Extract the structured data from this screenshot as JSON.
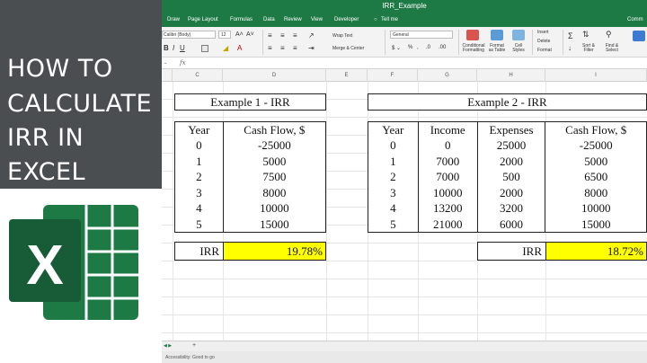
{
  "banner": {
    "lines": [
      "HOW TO",
      "CALCULATE",
      "IRR IN",
      "EXCEL"
    ],
    "bg_color": "#4b4e51",
    "logo_icon": "excel-logo-icon",
    "logo_color": "#1e7a45"
  },
  "window": {
    "title": "IRR_Example",
    "menu": [
      "Draw",
      "Page Layout",
      "Formulas",
      "Data",
      "Review",
      "View",
      "Developer",
      "Tell me",
      "Comm"
    ],
    "accent": "#1e7a45"
  },
  "ribbon": {
    "font_name": "Calibri (Body)",
    "font_size": "12",
    "wrap_text": "Wrap Text",
    "merge_center": "Merge & Center",
    "number_format": "General",
    "conditional_formatting": "Conditional Formatting",
    "format_as_table": "Format as Table",
    "cell_styles": "Cell Styles",
    "insert": "Insert",
    "delete": "Delete",
    "format": "Format",
    "sort_filter": "Sort & Filter",
    "find_select": "Find & Select"
  },
  "formula_bar": {
    "fx": "fx"
  },
  "columns": [
    "C",
    "D",
    "E",
    "F",
    "G",
    "H",
    "I"
  ],
  "example1": {
    "title": "Example 1 - IRR",
    "headers": [
      "Year",
      "Cash Flow, $"
    ],
    "rows": [
      [
        "0",
        "-25000"
      ],
      [
        "1",
        "5000"
      ],
      [
        "2",
        "7500"
      ],
      [
        "3",
        "8000"
      ],
      [
        "4",
        "10000"
      ],
      [
        "5",
        "15000"
      ]
    ],
    "irr_label": "IRR",
    "irr_value": "19.78%"
  },
  "example2": {
    "title": "Example 2 - IRR",
    "headers": [
      "Year",
      "Income",
      "Expenses",
      "Cash Flow, $"
    ],
    "rows": [
      [
        "0",
        "0",
        "25000",
        "-25000"
      ],
      [
        "1",
        "7000",
        "2000",
        "5000"
      ],
      [
        "2",
        "7000",
        "500",
        "6500"
      ],
      [
        "3",
        "10000",
        "2000",
        "8000"
      ],
      [
        "4",
        "13200",
        "3200",
        "10000"
      ],
      [
        "5",
        "21000",
        "6000",
        "15000"
      ]
    ],
    "irr_label": "IRR",
    "irr_value": "18.72%"
  },
  "sheet_tab": "+",
  "status": "Accessibility: Good to go"
}
